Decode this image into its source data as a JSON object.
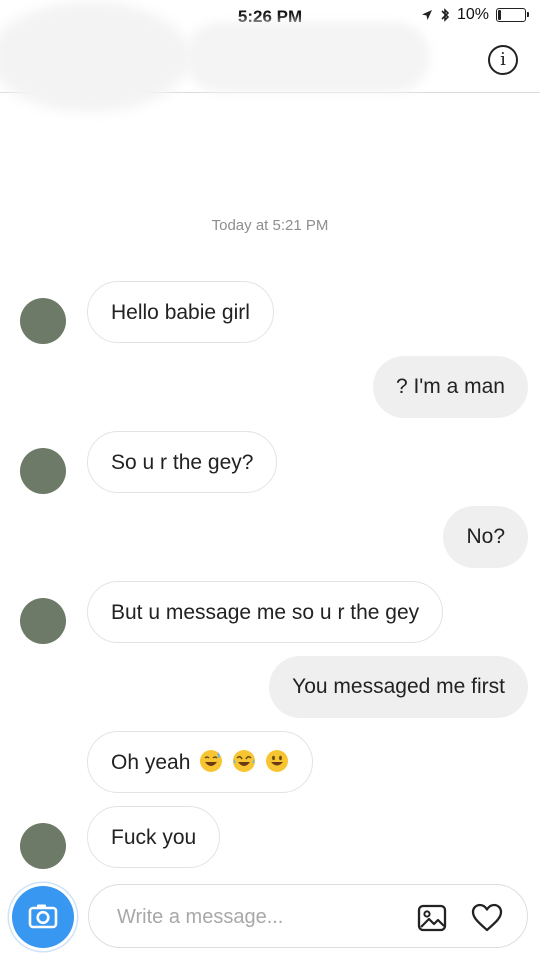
{
  "status": {
    "time": "5:26 PM",
    "battery": "10%",
    "battery_level": 0.1
  },
  "thread": {
    "timestamp": "Today at 5:21 PM"
  },
  "messages": [
    {
      "side": "in",
      "text": "Hello babie girl"
    },
    {
      "side": "out",
      "text": "? I'm a man"
    },
    {
      "side": "in",
      "text": "So u r the gey?"
    },
    {
      "side": "out",
      "text": "No?"
    },
    {
      "side": "in",
      "text": "But u message me so u r the gey"
    },
    {
      "side": "out",
      "text": "You messaged me first"
    },
    {
      "side": "in",
      "text": "Oh yeah",
      "emojis": [
        "sweat-smile-emoji",
        "joy-emoji",
        "grinning-emoji"
      ]
    },
    {
      "side": "in",
      "text": "Fuck you"
    }
  ],
  "composer": {
    "placeholder": "Write a message..."
  },
  "icons": [
    "location-arrow-icon",
    "bluetooth-icon",
    "battery-icon",
    "info-icon",
    "camera-icon",
    "gallery-icon",
    "heart-icon"
  ],
  "colors": {
    "accent": "#3897f0",
    "outgoing_bubble": "#efefef",
    "incoming_border": "#e3e3e3",
    "muted_text": "#8e8e8e"
  }
}
